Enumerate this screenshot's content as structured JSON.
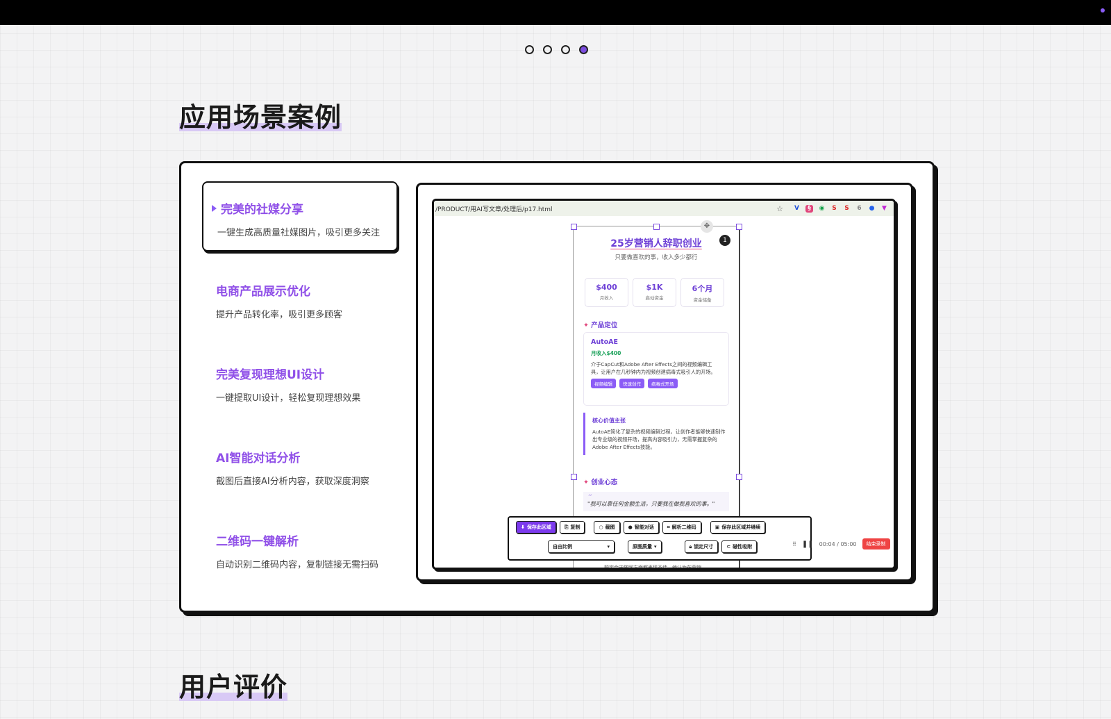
{
  "pager": {
    "count": 4,
    "active_index": 3
  },
  "sections": {
    "cases_title": "应用场景案例",
    "reviews_title": "用户评价"
  },
  "cases": [
    {
      "title": "完美的社媒分享",
      "desc": "一键生成高质量社媒图片，吸引更多关注"
    },
    {
      "title": "电商产品展示优化",
      "desc": "提升产品转化率，吸引更多顾客"
    },
    {
      "title": "完美复现理想UI设计",
      "desc": "一键提取UI设计，轻松复现理想效果"
    },
    {
      "title": "AI智能对话分析",
      "desc": "截图后直接AI分析内容，获取深度洞察"
    },
    {
      "title": "二维码一键解析",
      "desc": "自动识别二维码内容，复制链接无需扫码"
    }
  ],
  "active_case": 0,
  "browser": {
    "url": "/PRODUCT/用AI写文章/处理后/p17.html",
    "star_icon": "star-icon",
    "extensions": [
      "V",
      "§",
      "◉",
      "S",
      "S",
      "6",
      "●",
      "▼"
    ]
  },
  "card": {
    "title": "25岁营销人辞职创业",
    "subtitle": "只要做喜欢的事，收入多少都行",
    "badge": "1",
    "stats": [
      {
        "value": "$400",
        "label": "月收入"
      },
      {
        "value": "$1K",
        "label": "启动资金"
      },
      {
        "value": "6个月",
        "label": "资金储备"
      }
    ],
    "section1": "产品定位",
    "product": {
      "name": "AutoAE",
      "income": "月收入$400",
      "desc": "介于CapCut和Adobe After Effects之间的视频编辑工具，让用户在几秒钟内为视频创建病毒式吸引人的开场。",
      "tags": [
        "视频编辑",
        "快速创作",
        "病毒式开场"
      ]
    },
    "core": {
      "heading": "核心价值主张",
      "text": "AutoAE简化了复杂的视频编辑过程，让创作者能够快速制作出专业级的视频开场，提高内容吸引力，无需掌握复杂的Adobe After Effects技能。"
    },
    "section2": "创业心态",
    "quote": "\"我可以靠任何金额生活，只要我在做我喜欢的事。\"",
    "bottom": "题定会守做网方面都表现不佳。他认为在营销..."
  },
  "toolbar": {
    "row1": [
      "保存此区域",
      "复制",
      "截图",
      "智能对话",
      "解析二维码",
      "保存此区域并继续"
    ],
    "row2": [
      "自由比例",
      "原图质量",
      "锁定尺寸",
      "磁性吸附"
    ]
  },
  "recording": {
    "time": "00:04 / 05:00",
    "stop_label": "结束录制"
  },
  "colors": {
    "accent": "#7c3aed",
    "title_purple": "#9050e8",
    "stop_red": "#ef4444"
  }
}
